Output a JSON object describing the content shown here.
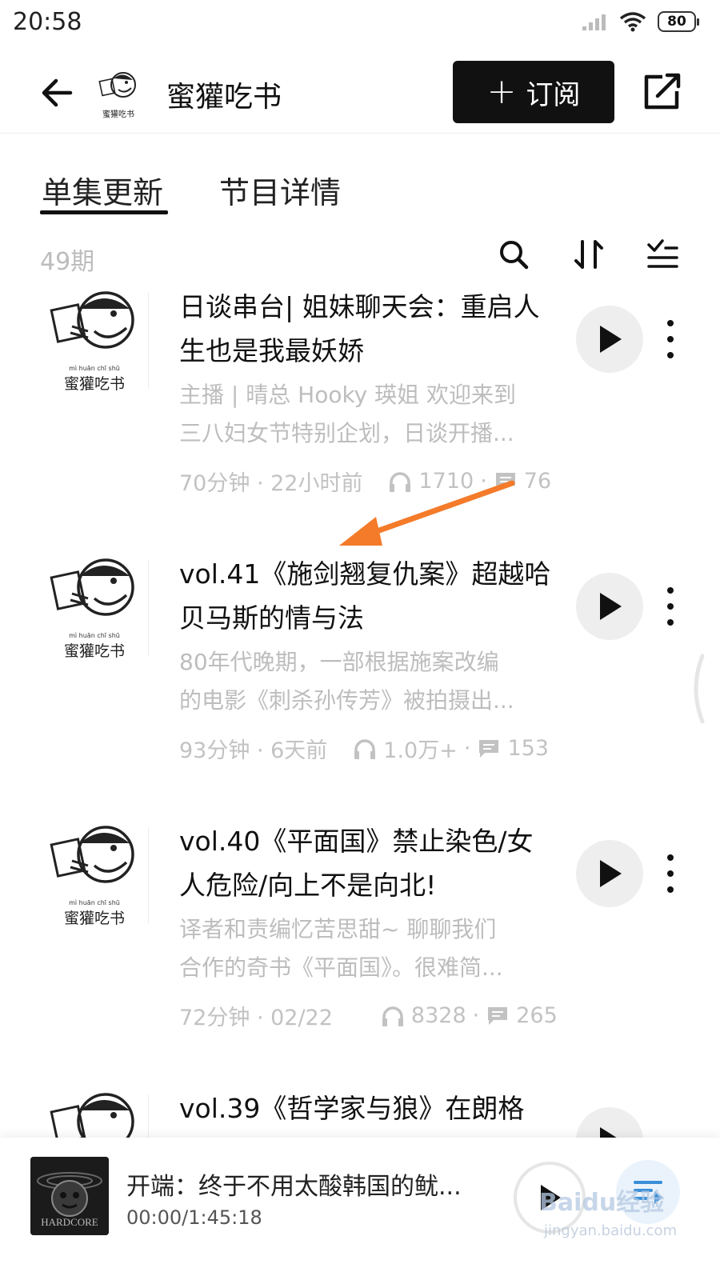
{
  "status_bar": {
    "time": "20:58",
    "battery": "80"
  },
  "header": {
    "title": "蜜獾吃书",
    "subscribe_label": "订阅",
    "logo_caption": "蜜獾吃书"
  },
  "tabs": [
    {
      "label": "单集更新",
      "active": true
    },
    {
      "label": "节目详情",
      "active": false
    }
  ],
  "episode_count": "49期",
  "episodes": [
    {
      "title": "日谈串台| 姐妹聊天会：重启人生也是我最妖娇",
      "desc_line1": "主播 | 晴总 Hooky 瑛姐 欢迎来到",
      "desc_line2": "三八妇女节特别企划，日谈开播...",
      "duration": "70分钟 · 22小时前",
      "plays": "1710",
      "comments": "76",
      "thumb_caption": "蜜獾吃书",
      "thumb_pinyin": "mì  huān  chī  shū"
    },
    {
      "title": "vol.41《施剑翘复仇案》超越哈贝马斯的情与法",
      "desc_line1": "80年代晚期，一部根据施案改编",
      "desc_line2": "的电影《刺杀孙传芳》被拍摄出...",
      "duration": "93分钟 · 6天前",
      "plays": "1.0万+",
      "comments": "153",
      "thumb_caption": "蜜獾吃书",
      "thumb_pinyin": "mì  huān  chī  shū"
    },
    {
      "title": "vol.40《平面国》禁止染色/女人危险/向上不是向北!",
      "desc_line1": "译者和责编忆苦思甜~ 聊聊我们",
      "desc_line2": "合作的奇书《平面国》。很难简...",
      "duration": "72分钟 · 02/22",
      "plays": "8328",
      "comments": "265",
      "thumb_caption": "蜜獾吃书",
      "thumb_pinyin": "mì  huān  chī  shū"
    },
    {
      "title": "vol.39《哲学家与狼》在朗格",
      "thumb_caption": "",
      "thumb_pinyin": ""
    }
  ],
  "player": {
    "title": "开端：终于不用太酸韩国的鱿...",
    "time": "00:00/1:45:18",
    "cover_text": "HARDCORE"
  },
  "watermark": {
    "main": "Baidu经验",
    "sub": "jingyan.baidu.com"
  },
  "colors": {
    "annotation_arrow": "#f47b2a",
    "accent_dark": "#111111",
    "muted_text": "#bdbdbd"
  }
}
